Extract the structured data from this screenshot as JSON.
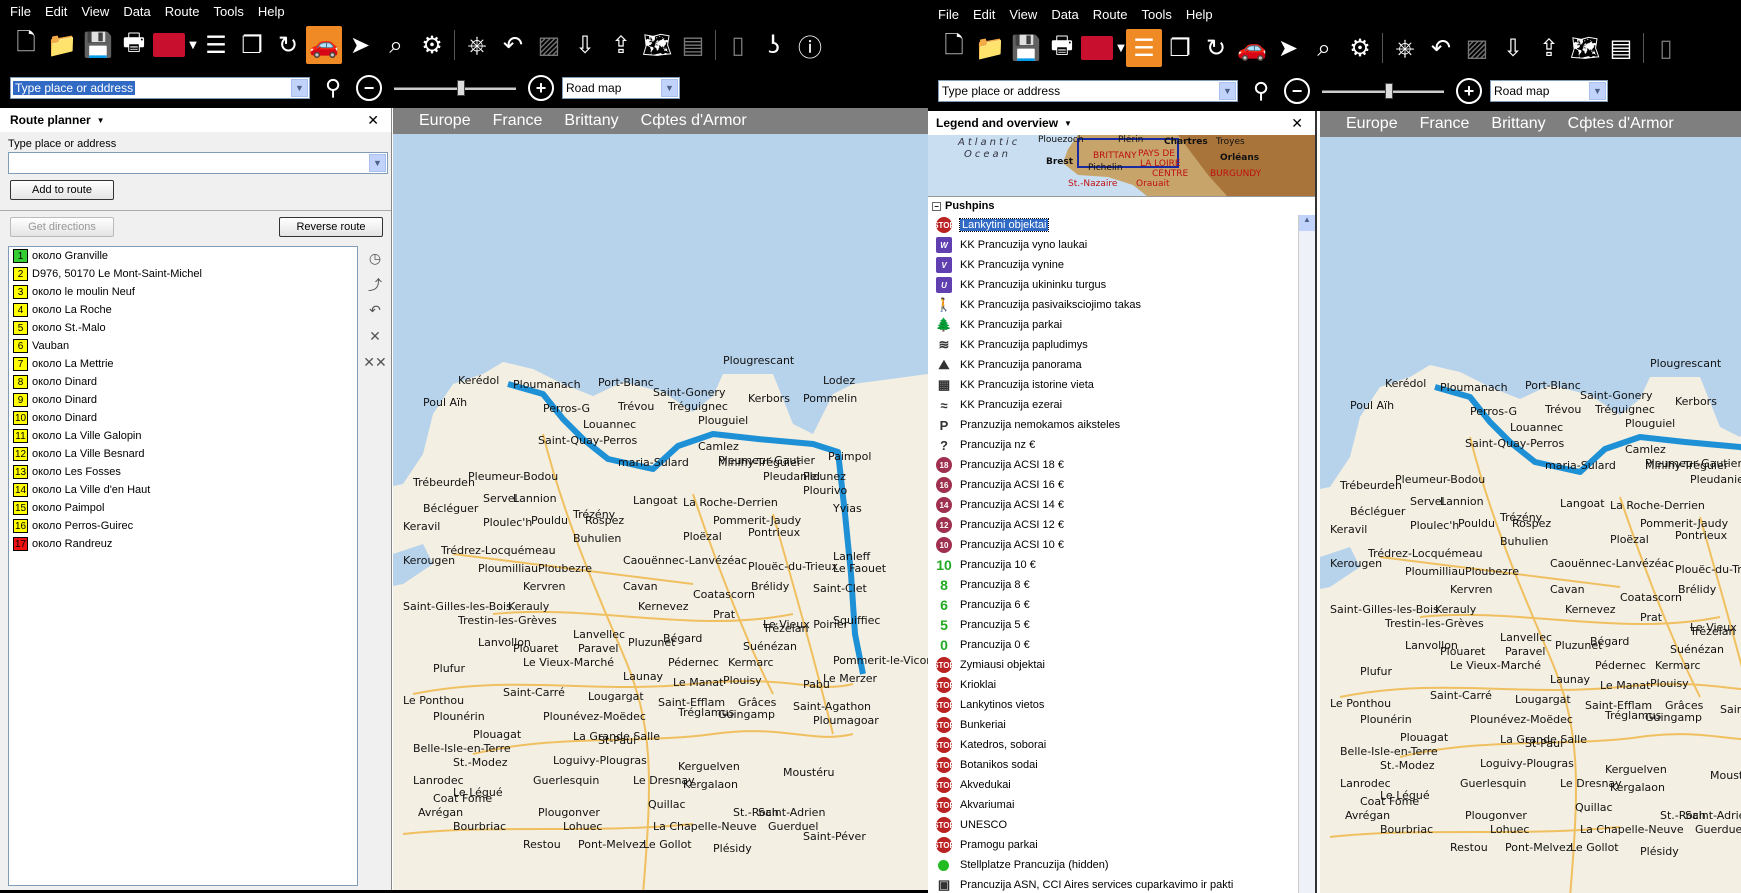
{
  "left": {
    "menu": [
      "File",
      "Edit",
      "View",
      "Data",
      "Route",
      "Tools",
      "Help"
    ],
    "search": {
      "value": "Type place or address"
    },
    "map_style": "Road map",
    "zoom_level": 0.55,
    "route_planner": {
      "title": "Route planner",
      "field_label": "Type place or address",
      "add_button": "Add to route",
      "directions_button": "Get directions",
      "reverse_button": "Reverse route",
      "stops": [
        {
          "n": "1",
          "label": "около Granville",
          "color": "green"
        },
        {
          "n": "2",
          "label": "D976, 50170 Le Mont-Saint-Michel",
          "color": "yellow"
        },
        {
          "n": "3",
          "label": "около le moulin Neuf",
          "color": "yellow"
        },
        {
          "n": "4",
          "label": "около La Roche",
          "color": "yellow"
        },
        {
          "n": "5",
          "label": "около St.-Malo",
          "color": "yellow"
        },
        {
          "n": "6",
          "label": "Vauban",
          "color": "yellow"
        },
        {
          "n": "7",
          "label": "около La Mettrie",
          "color": "yellow"
        },
        {
          "n": "8",
          "label": "около Dinard",
          "color": "yellow"
        },
        {
          "n": "9",
          "label": "около Dinard",
          "color": "yellow"
        },
        {
          "n": "10",
          "label": "около Dinard",
          "color": "yellow"
        },
        {
          "n": "11",
          "label": "около La Ville Galopin",
          "color": "yellow"
        },
        {
          "n": "12",
          "label": "около La Ville Besnard",
          "color": "yellow"
        },
        {
          "n": "13",
          "label": "около Les Fosses",
          "color": "yellow"
        },
        {
          "n": "14",
          "label": "около La Ville d'en Haut",
          "color": "yellow"
        },
        {
          "n": "15",
          "label": "около Paimpol",
          "color": "yellow"
        },
        {
          "n": "16",
          "label": "около Perros-Guirec",
          "color": "yellow"
        },
        {
          "n": "17",
          "label": "около Randreuz",
          "color": "red"
        }
      ]
    },
    "breadcrumb": [
      "Europe",
      "France",
      "Brittany",
      "Cфtes d'Armor"
    ]
  },
  "right": {
    "menu": [
      "File",
      "Edit",
      "View",
      "Data",
      "Route",
      "Tools",
      "Help"
    ],
    "search": {
      "value": "Type place or address"
    },
    "map_style": "Road map",
    "zoom_level": 0.55,
    "legend": {
      "title": "Legend and overview",
      "overview_labels": [
        "Atlantic",
        "Ocean",
        "Brest",
        "Plouezoch",
        "Plérin",
        "Chartres",
        "Troyes",
        "BRITTANY",
        "PAYS DE",
        "LA LOIRE",
        "Orléans",
        "Pichelin",
        "CENTRE",
        "BURGUNDY",
        "St.-Nazaire",
        "Orauait"
      ],
      "pushpins_header": "Pushpins",
      "pushpins": [
        {
          "label": "Lankytini objektai",
          "icon": "stop-sign-icon",
          "selected": true
        },
        {
          "label": "KK Prancuzija vyno laukai",
          "icon": "wine-field-icon"
        },
        {
          "label": "KK Prancuzija vynine",
          "icon": "winery-icon"
        },
        {
          "label": "KK Prancuzija ukininku turgus",
          "icon": "farmers-market-icon"
        },
        {
          "label": "KK Prancuzija pasivaiksciojimo takas",
          "icon": "walking-trail-icon"
        },
        {
          "label": "KK Prancuzija parkai",
          "icon": "park-tree-icon"
        },
        {
          "label": "KK Prancuzija papludimys",
          "icon": "beach-icon"
        },
        {
          "label": "KK Prancuzija panorama",
          "icon": "panorama-icon"
        },
        {
          "label": "KK Prancuzija istorine vieta",
          "icon": "historic-site-icon"
        },
        {
          "label": "KK Prancuzija ezerai",
          "icon": "lake-icon"
        },
        {
          "label": "Pranzuzija nemokamos aiksteles",
          "icon": "parking-icon"
        },
        {
          "label": "Prancuzija nz €",
          "icon": "question-icon"
        },
        {
          "label": "Prancuzija ACSI 18 €",
          "icon": "acsi-18-icon",
          "badge": "18"
        },
        {
          "label": "Prancuzija ACSI 16 €",
          "icon": "acsi-16-icon",
          "badge": "16"
        },
        {
          "label": "Prancuzija ACSI 14 €",
          "icon": "acsi-14-icon",
          "badge": "14"
        },
        {
          "label": "Prancuzija ACSI 12 €",
          "icon": "acsi-12-icon",
          "badge": "12"
        },
        {
          "label": "Prancuzija ACSI 10 €",
          "icon": "acsi-10-icon",
          "badge": "10"
        },
        {
          "label": "Prancuzija 10 €",
          "icon": "price-10-icon",
          "badge": "10"
        },
        {
          "label": "Prancuzija 8 €",
          "icon": "price-8-icon",
          "badge": "8"
        },
        {
          "label": "Prancuzija 6 €",
          "icon": "price-6-icon",
          "badge": "6"
        },
        {
          "label": "Prancuzija 5 €",
          "icon": "price-5-icon",
          "badge": "5"
        },
        {
          "label": "Prancuzija 0 €",
          "icon": "price-0-icon",
          "badge": "0"
        },
        {
          "label": "Zymiausi objektai",
          "icon": "stop-sign-icon"
        },
        {
          "label": "Krioklai",
          "icon": "stop-sign-icon"
        },
        {
          "label": "Lankytinos vietos",
          "icon": "stop-sign-icon"
        },
        {
          "label": "Bunkeriai",
          "icon": "stop-sign-icon"
        },
        {
          "label": "Katedros, soborai",
          "icon": "stop-sign-icon"
        },
        {
          "label": "Botanikos sodai",
          "icon": "stop-sign-icon"
        },
        {
          "label": "Akvedukai",
          "icon": "stop-sign-icon"
        },
        {
          "label": "Akvariumai",
          "icon": "stop-sign-icon"
        },
        {
          "label": "UNESCO",
          "icon": "stop-sign-icon"
        },
        {
          "label": "Pramogu parkai",
          "icon": "stop-sign-icon"
        },
        {
          "label": "Stellplatze Prancuzija (hidden)",
          "icon": "green-dot-icon"
        },
        {
          "label": "Prancuzija ASN, CCI Aires services cuparkavimo ir pakti",
          "icon": "service-area-icon"
        }
      ]
    },
    "breadcrumb": [
      "Europe",
      "France",
      "Brittany",
      "Cфtes d'Armor"
    ]
  },
  "map_labels": [
    "Plougrescant",
    "Kerédol",
    "Ploumanach",
    "Port-Blanc",
    "Saint-Gonery",
    "Poul Aïh",
    "Perros-G",
    "Trévou",
    "Tréguignec",
    "Kerbors",
    "Pommelin",
    "Lodez",
    "Louannec",
    "Plouguiel",
    "Saint-Quay-Perros",
    "Camlez",
    "Pleumeur-Gautier",
    "Paimpol",
    "Pleumeur-Bodou",
    "maria-Sulard",
    "Minihy-Tréguier",
    "Pleudaniel",
    "Plounez",
    "Plourivo",
    "Trébeurden",
    "Servel",
    "Lannion",
    "Trézény",
    "Langoat",
    "La Roche-Derrien",
    "Yvias",
    "Ploulec'h",
    "Pouldu",
    "Rospez",
    "Pommerit-Jaudy",
    "Lanleff",
    "Le Faouet",
    "Bécléguer",
    "Keravil",
    "Buhulien",
    "Ploëzal",
    "Pontrieux",
    "Trédrez-Locquémeau",
    "Caouënnec-Lanvézéac",
    "Plouëc-du-Trieux",
    "Kerougen",
    "Ploumilliau",
    "Ploubezre",
    "Kervren",
    "Cavan",
    "Coatascorn",
    "Brélidy",
    "Saint-Clet",
    "Saint-Gilles-les-Bois",
    "Trestin-les-Grèves",
    "Kerauly",
    "Kernevez",
    "Prat",
    "Trézelan",
    "Squiffiec",
    "Lanvollon",
    "Lanvellec",
    "Pluzunet",
    "Bégard",
    "Suénézan",
    "Le Vieux Poirier",
    "Plufur",
    "Plouaret",
    "Paravel",
    "Le Vieux-Marché",
    "Pédernec",
    "Kermarc",
    "Pommerit-le-Vicomte",
    "Launay",
    "Le Manat",
    "Plouisy",
    "Pabu",
    "Le Merzer",
    "Le Ponthou",
    "Saint-Carré",
    "Lougargat",
    "Saint-Efflam",
    "Grâces",
    "Saint-Agathon",
    "Plounérin",
    "Plounévez-Moëdec",
    "Tréglamus",
    "Guingamp",
    "Ploumagoar",
    "Plouagat",
    "La Grande Salle",
    "St-Paul",
    "Belle-Isle-en-Terre",
    "St.-Modez",
    "Loguivy-Plougras",
    "Kerguelven",
    "Moustéru",
    "Lanrodec",
    "Guerlesquin",
    "Le Dresnay",
    "Kergalaon",
    "Coat Fome",
    "Le Légué",
    "Avrégan",
    "Plougonver",
    "Quillac",
    "St.-Roch",
    "Saint-Adrien",
    "Bourbriac",
    "Lohuec",
    "La Chapelle-Neuve",
    "Guerduel",
    "Saint-Péver",
    "Restou",
    "Pont-Melvez",
    "Le Gollot",
    "Plésidy"
  ]
}
